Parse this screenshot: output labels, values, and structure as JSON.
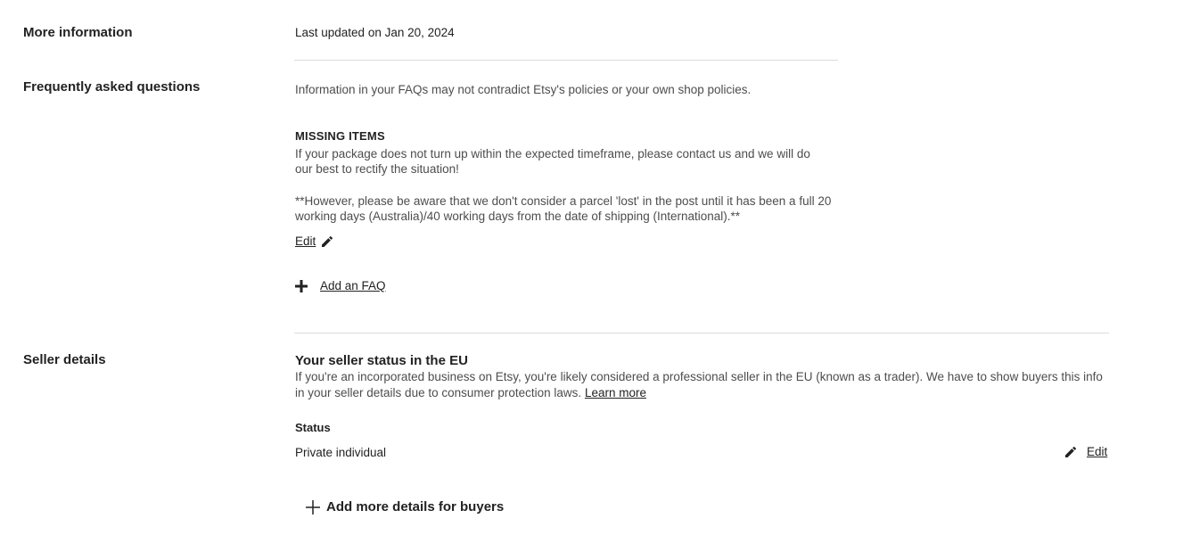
{
  "more_information": {
    "label": "More information",
    "last_updated": "Last updated on Jan 20, 2024"
  },
  "faq": {
    "label": "Frequently asked questions",
    "notice": "Information in your FAQs may not contradict Etsy's policies or your own shop policies.",
    "items": [
      {
        "title": "MISSING ITEMS",
        "paragraph_1_line_1": "If your package does not turn up within the expected timeframe, please contact us and we will do",
        "paragraph_1_line_2": "our best to rectify the situation!",
        "paragraph_2_line_1": "**However, please be aware that we don't consider a parcel 'lost' in the post until it has been a full 20",
        "paragraph_2_line_2": "working days (Australia)/40 working days from the date of shipping (International).**",
        "edit_label": "Edit"
      }
    ],
    "add_label": "Add an FAQ"
  },
  "seller_details": {
    "label": "Seller details",
    "eu_heading": "Your seller status in the EU",
    "eu_text_line_1": "If you're an incorporated business on Etsy, you're likely considered a professional seller in the EU (known as a trader). We have to show buyers this info",
    "eu_text_line_2": "in your seller details due to consumer protection laws.",
    "learn_more": "Learn more",
    "status_label": "Status",
    "status_value": "Private individual",
    "edit_label": "Edit",
    "add_details_label": "Add more details for buyers"
  },
  "icons": {
    "pencil": "pencil-icon",
    "plus_bold": "plus-icon",
    "plus_thin": "plus-icon"
  }
}
